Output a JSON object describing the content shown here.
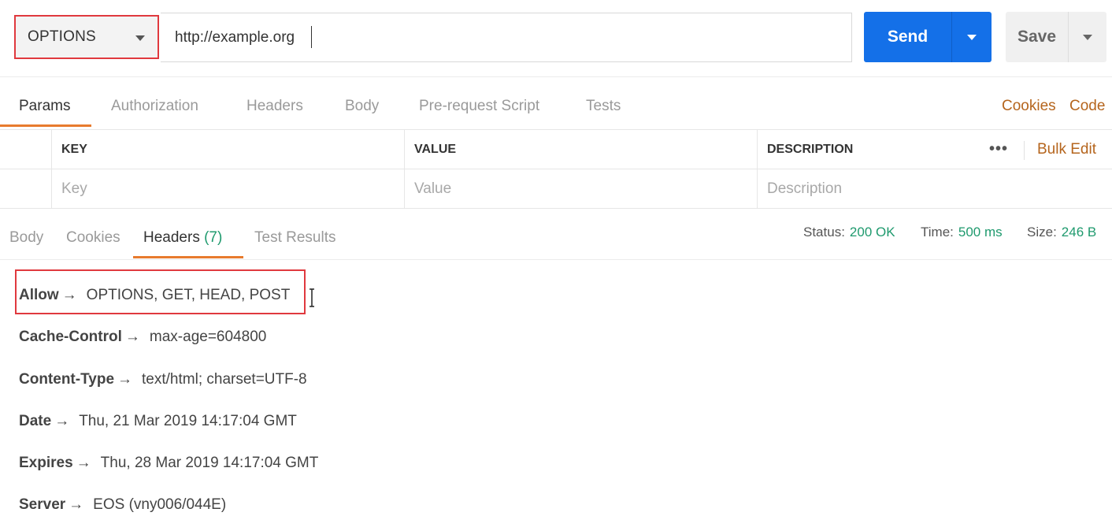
{
  "request": {
    "method": "OPTIONS",
    "url": "http://example.org",
    "send_label": "Send",
    "save_label": "Save"
  },
  "request_tabs": [
    {
      "label": "Params"
    },
    {
      "label": "Authorization"
    },
    {
      "label": "Headers"
    },
    {
      "label": "Body"
    },
    {
      "label": "Pre-request Script"
    },
    {
      "label": "Tests"
    }
  ],
  "request_links": {
    "cookies": "Cookies",
    "code": "Code"
  },
  "params_table": {
    "columns": {
      "key": "KEY",
      "value": "VALUE",
      "description": "DESCRIPTION"
    },
    "placeholders": {
      "key": "Key",
      "value": "Value",
      "description": "Description"
    },
    "more_label": "•••",
    "bulk_edit": "Bulk Edit"
  },
  "response_tabs": [
    {
      "label": "Body"
    },
    {
      "label": "Cookies"
    },
    {
      "label": "Headers",
      "count": "(7)"
    },
    {
      "label": "Test Results"
    }
  ],
  "response_meta": {
    "status_label": "Status:",
    "status_value": "200 OK",
    "time_label": "Time:",
    "time_value": "500 ms",
    "size_label": "Size:",
    "size_value": "246 B"
  },
  "response_headers": [
    {
      "key": "Allow",
      "value": "OPTIONS, GET, HEAD, POST"
    },
    {
      "key": "Cache-Control",
      "value": "max-age=604800"
    },
    {
      "key": "Content-Type",
      "value": "text/html; charset=UTF-8"
    },
    {
      "key": "Date",
      "value": "Thu, 21 Mar 2019 14:17:04 GMT"
    },
    {
      "key": "Expires",
      "value": "Thu, 28 Mar 2019 14:17:04 GMT"
    },
    {
      "key": "Server",
      "value": "EOS (vny006/044E)"
    }
  ],
  "arrow_glyph": "→",
  "colors": {
    "accent_orange": "#e87b2e",
    "link_brown": "#b5651d",
    "send_blue": "#1470e8",
    "success_green": "#1f9a6e",
    "highlight_red": "#e0393e"
  }
}
